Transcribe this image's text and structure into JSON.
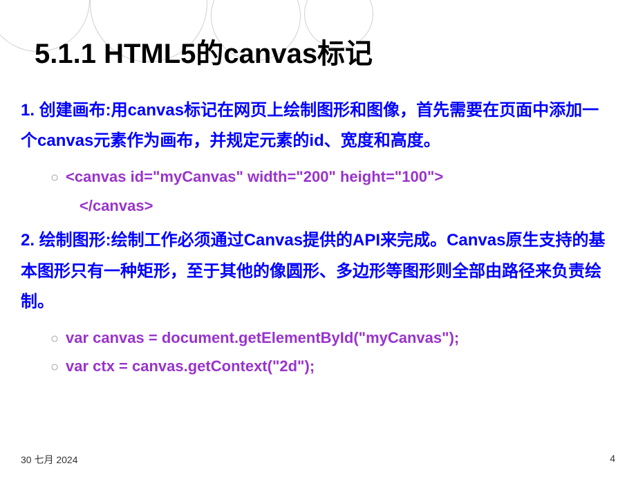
{
  "title": "5.1.1  HTML5的canvas标记",
  "section1": {
    "text": "1.  创建画布:用canvas标记在网页上绘制图形和图像，首先需要在页面中添加一个canvas元素作为画布，并规定元素的id、宽度和高度。",
    "code1": "<canvas id=\"myCanvas\" width=\"200\" height=\"100\">",
    "code2": "</canvas>"
  },
  "section2": {
    "text": "2.  绘制图形:绘制工作必须通过Canvas提供的API来完成。Canvas原生支持的基本图形只有一种矩形，至于其他的像圆形、多边形等图形则全部由路径来负责绘制。",
    "code1": "var canvas = document.getElementById(\"myCanvas\");",
    "code2": "var ctx = canvas.getContext(\"2d\");"
  },
  "footer": {
    "date": "30 七月 2024",
    "page": "4"
  },
  "bullet": "○"
}
